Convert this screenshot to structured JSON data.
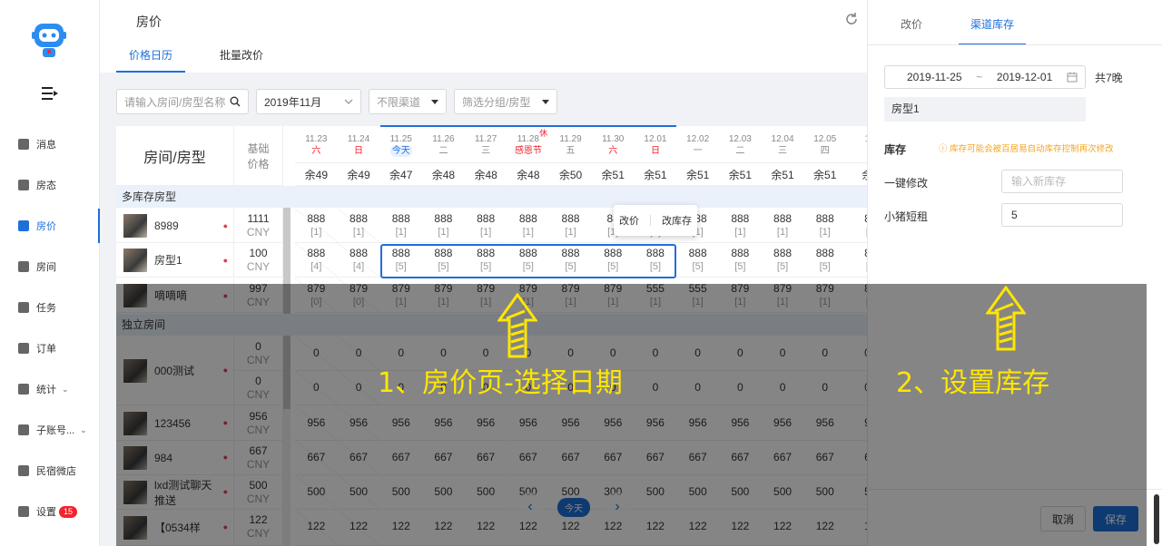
{
  "sidebar": {
    "logo": "robot-logo",
    "items": [
      {
        "label": "消息",
        "icon": "chat-icon"
      },
      {
        "label": "房态",
        "icon": "calendar-icon"
      },
      {
        "label": "房价",
        "icon": "price-icon",
        "active": true
      },
      {
        "label": "房间",
        "icon": "house-icon"
      },
      {
        "label": "任务",
        "icon": "task-icon"
      },
      {
        "label": "订单",
        "icon": "order-icon"
      },
      {
        "label": "统计",
        "icon": "chart-icon"
      },
      {
        "label": "子账号...",
        "icon": "users-icon"
      },
      {
        "label": "民宿微店",
        "icon": "shop-icon"
      },
      {
        "label": "设置",
        "icon": "gear-icon",
        "badge": "15"
      }
    ]
  },
  "header": {
    "title": "房价",
    "tabs": [
      "价格日历",
      "批量改价"
    ]
  },
  "filters": {
    "search_placeholder": "请输入房间/房型名称",
    "month": "2019年11月",
    "channel": "不限渠道",
    "group": "筛选分组/房型"
  },
  "grid": {
    "room_header": "房间/房型",
    "base_header_1": "基础",
    "base_header_2": "价格",
    "dates": [
      {
        "d": "11.23",
        "w": "六",
        "rem": "余49",
        "red": true
      },
      {
        "d": "11.24",
        "w": "日",
        "rem": "余49",
        "red": true
      },
      {
        "d": "11.25",
        "w": "今天",
        "rem": "余47",
        "today": true
      },
      {
        "d": "11.26",
        "w": "二",
        "rem": "余48"
      },
      {
        "d": "11.27",
        "w": "三",
        "rem": "余48"
      },
      {
        "d": "11.28",
        "w": "感恩节",
        "rem": "余48",
        "red": true,
        "tag": "休"
      },
      {
        "d": "11.29",
        "w": "五",
        "rem": "余50"
      },
      {
        "d": "11.30",
        "w": "六",
        "rem": "余51",
        "red": true
      },
      {
        "d": "12.01",
        "w": "日",
        "rem": "余51",
        "red": true
      },
      {
        "d": "12.02",
        "w": "一",
        "rem": "余51"
      },
      {
        "d": "12.03",
        "w": "二",
        "rem": "余51"
      },
      {
        "d": "12.04",
        "w": "三",
        "rem": "余51"
      },
      {
        "d": "12.05",
        "w": "四",
        "rem": "余51"
      },
      {
        "d": "1",
        "w": "",
        "rem": "余"
      }
    ],
    "group1": "多库存房型",
    "group2": "独立房间",
    "rows": [
      {
        "name": "8989",
        "base": "1111",
        "cur": "CNY",
        "prices": [
          "888",
          "888",
          "888",
          "888",
          "888",
          "888",
          "888",
          "88",
          "88",
          "888",
          "888",
          "888",
          "888",
          "8"
        ],
        "inv": [
          "[1]",
          "[1]",
          "[1]",
          "[1]",
          "[1]",
          "[1]",
          "[1]",
          "[1]",
          "[1]",
          "[1]",
          "[1]",
          "[1]",
          "[1]",
          "["
        ]
      },
      {
        "name": "房型1",
        "base": "100",
        "cur": "CNY",
        "prices": [
          "888",
          "888",
          "888",
          "888",
          "888",
          "888",
          "888",
          "888",
          "888",
          "888",
          "888",
          "888",
          "888",
          "8"
        ],
        "inv": [
          "[4]",
          "[4]",
          "[5]",
          "[5]",
          "[5]",
          "[5]",
          "[5]",
          "[5]",
          "[5]",
          "[5]",
          "[5]",
          "[5]",
          "[5]",
          "["
        ]
      },
      {
        "name": "嘀嘀嘀",
        "base": "997",
        "cur": "CNY",
        "prices": [
          "879",
          "879",
          "879",
          "879",
          "879",
          "879",
          "879",
          "879",
          "555",
          "555",
          "879",
          "879",
          "879",
          "8"
        ],
        "inv": [
          "[0]",
          "[0]",
          "[1]",
          "[1]",
          "[1]",
          "[1]",
          "[1]",
          "[1]",
          "[1]",
          "[1]",
          "[1]",
          "[1]",
          "[1]",
          "["
        ]
      }
    ],
    "rows2": [
      {
        "name": "000测试",
        "base": "0",
        "base2": "0",
        "cur": "CNY",
        "prices": [
          "0",
          "0",
          "0",
          "0",
          "0",
          "0",
          "0",
          "0",
          "0",
          "0",
          "0",
          "0",
          "0",
          "0"
        ],
        "prices2": [
          "0",
          "0",
          "0",
          "0",
          "0",
          "0",
          "0",
          "0",
          "0",
          "0",
          "0",
          "0",
          "0",
          "0"
        ]
      },
      {
        "name": "123456",
        "base": "956",
        "cur": "CNY",
        "prices": [
          "956",
          "956",
          "956",
          "956",
          "956",
          "956",
          "956",
          "956",
          "956",
          "956",
          "956",
          "956",
          "956",
          "9"
        ]
      },
      {
        "name": "984",
        "base": "667",
        "cur": "CNY",
        "prices": [
          "667",
          "667",
          "667",
          "667",
          "667",
          "667",
          "667",
          "667",
          "667",
          "667",
          "667",
          "667",
          "667",
          "6"
        ]
      },
      {
        "name": "lxd测试聊天推送",
        "base": "500",
        "cur": "CNY",
        "prices": [
          "500",
          "500",
          "500",
          "500",
          "500",
          "500",
          "500",
          "300",
          "500",
          "500",
          "500",
          "500",
          "500",
          "5"
        ]
      },
      {
        "name": "【0534样",
        "base": "122",
        "cur": "CNY",
        "prices": [
          "122",
          "122",
          "122",
          "122",
          "122",
          "122",
          "122",
          "122",
          "122",
          "122",
          "122",
          "122",
          "122",
          "1"
        ]
      }
    ],
    "popup": {
      "left": "改价",
      "right": "改库存"
    }
  },
  "pager": {
    "prev": "‹",
    "today": "今天",
    "next": "›"
  },
  "panel": {
    "tabs": [
      "改价",
      "渠道库存"
    ],
    "date_from": "2019-11-25",
    "date_sep": "~",
    "date_to": "2019-12-01",
    "nights": "共7晚",
    "room_tag": "房型1",
    "section": "库存",
    "warning": "ⓘ 库存可能会被百居易自动库存控制再次修改",
    "one_key_label": "一键修改",
    "one_key_placeholder": "输入新库存",
    "channel_label": "小猪短租",
    "channel_value": "5",
    "cancel": "取消",
    "save": "保存"
  },
  "overlay": {
    "step1": "1、房价页-选择日期",
    "step2": "2、设置库存"
  },
  "colors": {
    "accent": "#1e6fd9",
    "highlight": "#ffe600",
    "warn": "#f5a623"
  }
}
